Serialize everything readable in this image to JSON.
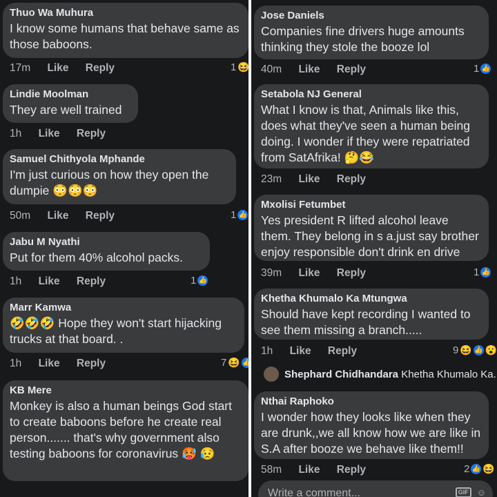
{
  "left": {
    "comments": [
      {
        "author": "Thuo Wa Muhura",
        "text": "I know some humans that behave same as those baboons.",
        "time": "17m",
        "like": "Like",
        "reply": "Reply",
        "reactions": "1"
      },
      {
        "author": "Lindie Moolman",
        "text": "They are well trained",
        "time": "1h",
        "like": "Like",
        "reply": "Reply",
        "reactions": ""
      },
      {
        "author": "Samuel Chithyola Mphande",
        "text": "I'm just curious on how they open the dumpie 😳😳😳",
        "time": "50m",
        "like": "Like",
        "reply": "Reply",
        "reactions": "1"
      },
      {
        "author": "Jabu M Nyathi",
        "text": "Put for  them 40% alcohol packs.",
        "time": "1h",
        "like": "Like",
        "reply": "Reply",
        "reactions": "1"
      },
      {
        "author": "Marr Kamwa",
        "text": "🤣🤣🤣 Hope they won't start hijacking trucks at that board. .",
        "time": "1h",
        "like": "Like",
        "reply": "Reply",
        "reactions": "7"
      },
      {
        "author": "KB Mere",
        "text": "Monkey is also a human beings God start to create baboons before he create real person....... that's why government also testing baboons for coronavirus 🥵 😥",
        "time": "",
        "like": "",
        "reply": "",
        "reactions": ""
      }
    ]
  },
  "right": {
    "comments": [
      {
        "author": "Jose Daniels",
        "text": "Companies fine drivers huge amounts thinking they stole the booze lol",
        "time": "40m",
        "like": "Like",
        "reply": "Reply",
        "reactions": "1"
      },
      {
        "author": "Setabola NJ General",
        "text": "What I know is that, Animals like this, does what they've seen a human being doing. I wonder if they were repatriated from SatAfrika! 🤔😂",
        "time": "23m",
        "like": "Like",
        "reply": "Reply",
        "reactions": ""
      },
      {
        "author": "Mxolisi Fetumbet",
        "text": "Yes president R lifted alcohol leave them. They belong in s a.just say brother enjoy responsible don't drink en drive",
        "time": "39m",
        "like": "Like",
        "reply": "Reply",
        "reactions": "1"
      },
      {
        "author": "Khetha Khumalo Ka Mtungwa",
        "text": "Should have kept recording I wanted to see them missing a branch.....",
        "time": "1h",
        "like": "Like",
        "reply": "Reply",
        "reactions": "9"
      },
      {
        "author": "Nthai Raphoko",
        "text": "I wonder how they looks like when they are drunk,,we all know how we are like in S.A after booze we behave like them!!",
        "time": "58m",
        "like": "Like",
        "reply": "Reply",
        "reactions": "2"
      }
    ],
    "reply_preview": {
      "author": "Shephard Chidhandara",
      "text": "Khetha Khumalo Ka..."
    },
    "composer": {
      "placeholder": "Write a comment...",
      "gif": "GIF"
    }
  },
  "colors": {
    "background": "#18191a",
    "bubble": "#3a3b3c",
    "like_blue": "#1877f2",
    "meta_gray": "#b0b3b8"
  }
}
